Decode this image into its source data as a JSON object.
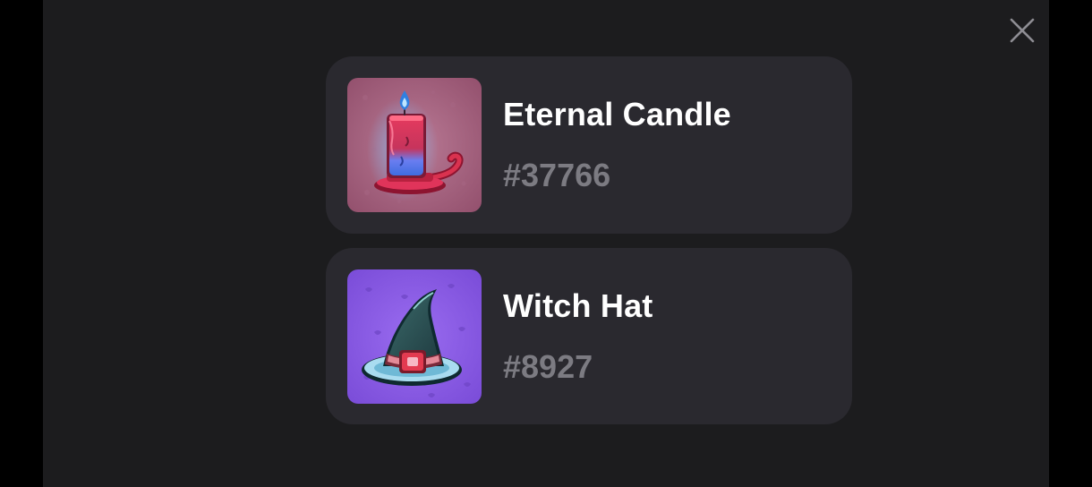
{
  "close": {
    "icon": "close-icon"
  },
  "items": [
    {
      "name": "Eternal Candle",
      "id": "#37766",
      "icon": "candle-icon",
      "thumb_color": "#a05a78"
    },
    {
      "name": "Witch Hat",
      "id": "#8927",
      "icon": "witch-hat-icon",
      "thumb_color": "#8a5ce0"
    }
  ],
  "colors": {
    "backdrop": "#000000",
    "modal_bg": "#1c1c1e",
    "card_bg": "#2a292f",
    "name_text": "#ffffff",
    "id_text": "#7c7b82"
  }
}
